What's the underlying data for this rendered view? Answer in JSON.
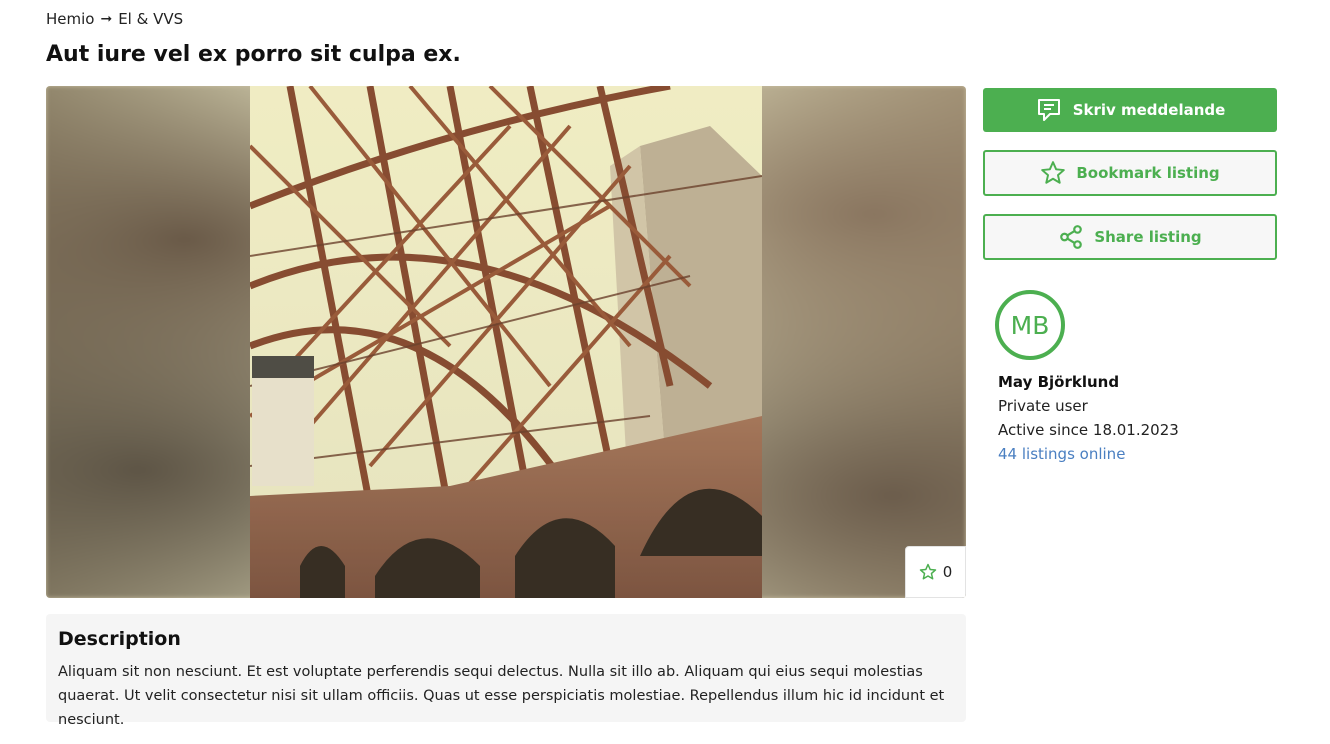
{
  "breadcrumb": {
    "root": "Hemio",
    "separator": "➞",
    "category": "El & VVS"
  },
  "listing": {
    "title": "Aut iure vel ex porro sit culpa ex.",
    "favorite_count": "0"
  },
  "description": {
    "heading": "Description",
    "text": "Aliquam sit non nesciunt. Et est voluptate perferendis sequi delectus. Nulla sit illo ab. Aliquam qui eius sequi molestias quaerat. Ut velit consectetur nisi sit ullam officiis. Quas ut esse perspiciatis molestiae. Repellendus illum hic id incidunt et nesciunt."
  },
  "actions": {
    "message_label": "Skriv meddelande",
    "bookmark_label": "Bookmark listing",
    "share_label": "Share listing"
  },
  "seller": {
    "initials": "MB",
    "name": "May Björklund",
    "type": "Private user",
    "active_since": "Active since 18.01.2023",
    "listings_link": "44 listings online"
  },
  "colors": {
    "accent": "#4caf50",
    "link": "#4a7fc1",
    "panel_bg": "#f5f5f5"
  },
  "icons": [
    "chat-icon",
    "star-icon",
    "share-icon",
    "star-outline-icon"
  ]
}
